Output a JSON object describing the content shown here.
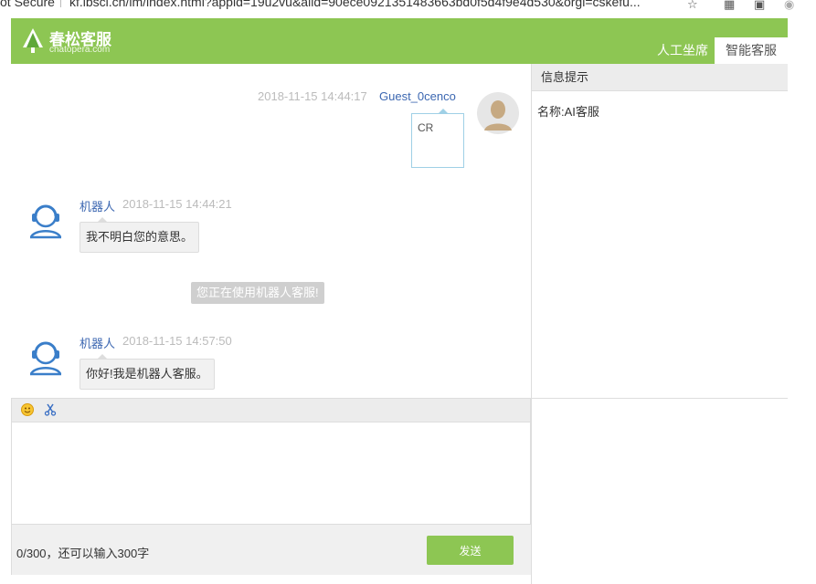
{
  "browser": {
    "security": "ot Secure",
    "url": "kf.ibsci.cn/im/index.html?appid=19u2vu&aiid=90ece0921351483663bd0f5d4f9e4d530&orgi=cskefu..."
  },
  "header": {
    "brand": "春松客服",
    "brand_sub": "chatopera.com",
    "tab_human": "人工坐席",
    "tab_ai": "智能客服"
  },
  "messages": {
    "guest": {
      "time": "2018-11-15 14:44:17",
      "name": "Guest_0cenco",
      "text": "CR"
    },
    "bot1": {
      "name": "机器人",
      "time": "2018-11-15 14:44:21",
      "text": "我不明白您的意思。"
    },
    "system": {
      "text": "您正在使用机器人客服!"
    },
    "bot2": {
      "name": "机器人",
      "time": "2018-11-15 14:57:50",
      "text": "你好!我是机器人客服。"
    }
  },
  "info": {
    "title": "信息提示",
    "name_row": "名称:AI客服"
  },
  "input": {
    "placeholder": "",
    "counter": "0/300，还可以输入300字",
    "send_label": "发送"
  },
  "colors": {
    "brand_green": "#8dc653",
    "link_blue": "#3c67b1",
    "guest_border": "#9fd0e6"
  }
}
